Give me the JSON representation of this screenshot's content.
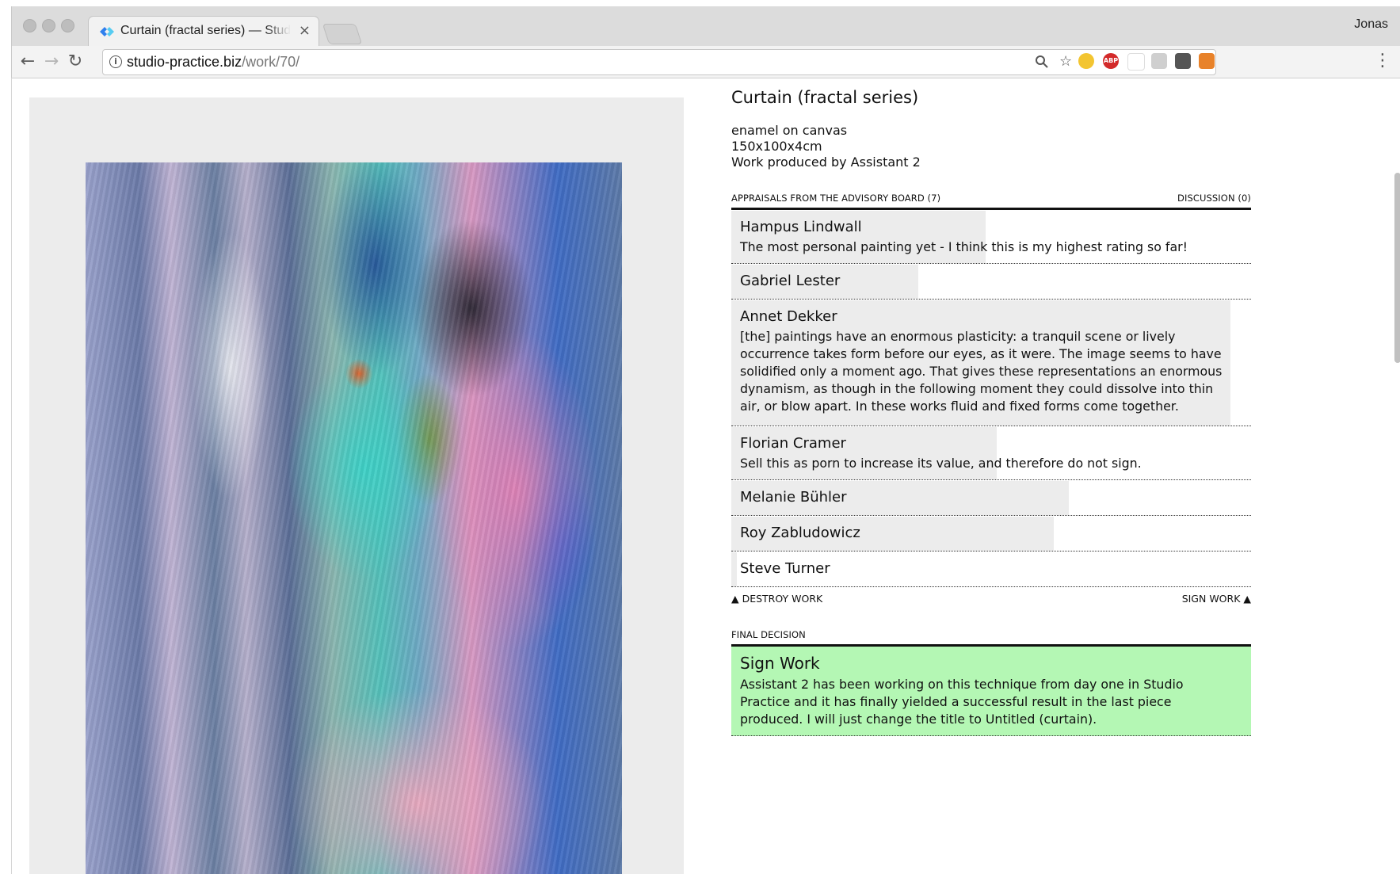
{
  "browser": {
    "tab_title": "Curtain (fractal series) — Studio Practice",
    "tab_close": "×",
    "profile_name": "Jonas",
    "url_host": "studio-practice.biz",
    "url_path": "/work/70/",
    "extensions": [
      {
        "icon": "face-extension-icon",
        "color": "#f3c531"
      },
      {
        "icon": "adblock-icon",
        "label": "ABP",
        "color": "#d32a2a"
      },
      {
        "icon": "blank-extension-icon",
        "color": "#ffffff"
      },
      {
        "icon": "page-extension-icon",
        "color": "#cfcfcf"
      },
      {
        "icon": "pocket-icon",
        "color": "#555555"
      },
      {
        "icon": "fox-extension-icon",
        "color": "#e8822a"
      }
    ]
  },
  "work": {
    "title": "Curtain (fractal series)",
    "medium": "enamel on canvas",
    "dimensions": "150x100x4cm",
    "producer": "Work produced by Assistant 2"
  },
  "appraisals": {
    "header": "Appraisals from the advisory board (7)",
    "discussion": "Discussion (0)",
    "items": [
      {
        "name": "Hampus Lindwall",
        "comment": "The most personal painting yet - I think this is my highest rating so far!",
        "rating": 0.49
      },
      {
        "name": "Gabriel Lester",
        "comment": "",
        "rating": 0.36
      },
      {
        "name": "Annet Dekker",
        "comment": "[the] paintings have an enormous plasticity: a tranquil scene or lively occurrence takes form before our eyes, as it were. The image seems to have solidified only a moment ago. That gives these representations an enormous dynamism, as though in the following moment they could dissolve into thin air, or blow apart. In these works fluid and fixed forms come together.",
        "rating": 0.96
      },
      {
        "name": "Florian Cramer",
        "comment": "Sell this as porn to increase its value, and therefore do not sign.",
        "rating": 0.51
      },
      {
        "name": "Melanie Bühler",
        "comment": "",
        "rating": 0.65
      },
      {
        "name": "Roy Zabludowicz",
        "comment": "",
        "rating": 0.62
      },
      {
        "name": "Steve Turner",
        "comment": "",
        "rating": 0.01
      }
    ]
  },
  "actions": {
    "destroy": "▲ Destroy work",
    "sign": "Sign work ▲"
  },
  "final": {
    "header": "Final decision",
    "decision": "Sign Work",
    "comment": "Assistant 2 has been working on this technique from day one in Studio Practice and it has finally yielded a successful result in the last piece produced. I will just change the title to Untitled (curtain).",
    "color": "#b4f7b4"
  }
}
